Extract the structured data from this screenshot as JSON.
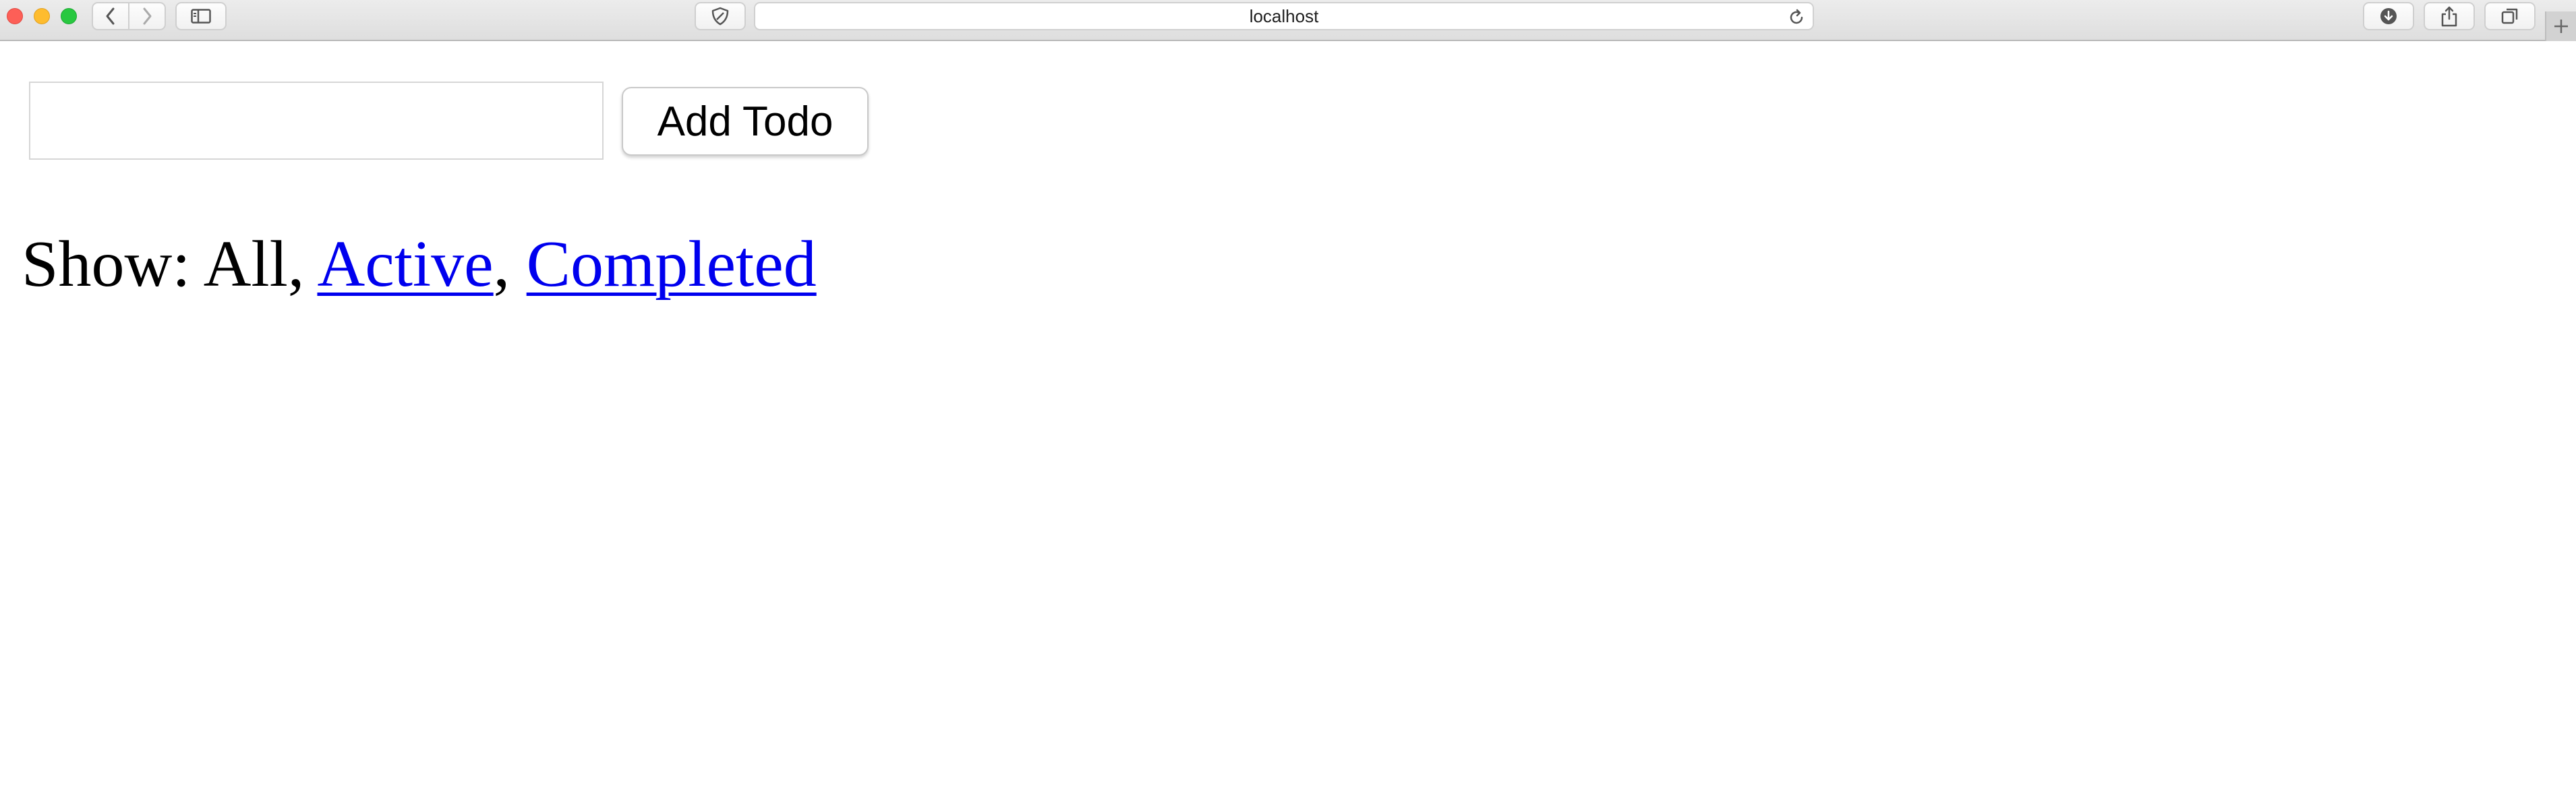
{
  "browser": {
    "address": "localhost",
    "icons": {
      "back": "chevron-left-icon",
      "forward": "chevron-right-icon",
      "sidebar": "sidebar-icon",
      "privacy": "shield-icon",
      "reload": "reload-icon",
      "download": "download-icon",
      "share": "share-icon",
      "tabs": "tabs-icon",
      "new_tab": "plus-icon"
    },
    "colors": {
      "close": "#fd5f57",
      "minimize": "#febc2e",
      "maximize": "#28c840"
    }
  },
  "todo_form": {
    "input_value": "",
    "add_button_label": "Add Todo"
  },
  "filters": {
    "prefix": "Show: ",
    "all_label": "All",
    "sep1": ", ",
    "active_label": "Active",
    "sep2": ", ",
    "completed_label": "Completed",
    "selected": "All",
    "link_color": "#0000ee"
  }
}
